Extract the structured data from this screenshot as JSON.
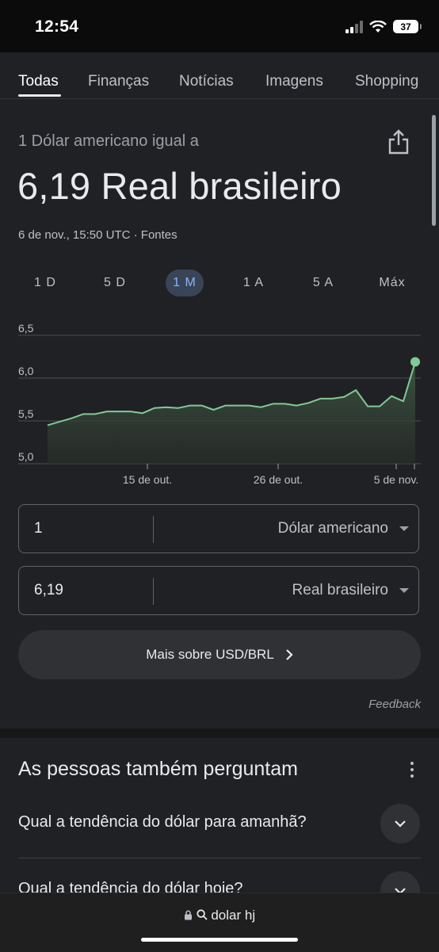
{
  "status_bar": {
    "time": "12:54",
    "battery": "37"
  },
  "tabs": [
    {
      "label": "Todas"
    },
    {
      "label": "Finanças"
    },
    {
      "label": "Notícias"
    },
    {
      "label": "Imagens"
    },
    {
      "label": "Shopping"
    }
  ],
  "converter_card": {
    "subtitle": "1 Dólar americano igual a",
    "rate": "6,19 Real brasileiro",
    "timestamp": "6 de nov., 15:50 UTC · Fontes",
    "ranges": [
      "1 D",
      "5 D",
      "1 M",
      "1 A",
      "5 A",
      "Máx"
    ],
    "active_range": "1 M"
  },
  "chart_data": {
    "type": "area",
    "x": [
      "5 de out.",
      "7 de out.",
      "8 de out.",
      "9 de out.",
      "10 de out.",
      "11 de out.",
      "14 de out.",
      "15 de out.",
      "16 de out.",
      "17 de out.",
      "18 de out.",
      "21 de out.",
      "22 de out.",
      "23 de out.",
      "24 de out.",
      "25 de out.",
      "26 de out.",
      "28 de out.",
      "29 de out.",
      "30 de out.",
      "31 de out.",
      "1 de nov.",
      "2 de nov.",
      "3 de nov.",
      "4 de nov.",
      "5 de nov.",
      "5 de nov. (2)",
      "6 de nov."
    ],
    "values": [
      5.45,
      5.49,
      5.53,
      5.58,
      5.58,
      5.61,
      5.61,
      5.61,
      5.59,
      5.65,
      5.66,
      5.65,
      5.68,
      5.68,
      5.63,
      5.68,
      5.68,
      5.68,
      5.66,
      5.7,
      5.7,
      5.68,
      5.71,
      5.76,
      5.76,
      5.78,
      5.86,
      5.67,
      5.67,
      5.79,
      5.73,
      6.19
    ],
    "y_ticks": [
      "6,5",
      "6,0",
      "5,5",
      "5,0"
    ],
    "x_ticks": [
      "15 de out.",
      "26 de out.",
      "5 de nov."
    ],
    "ylim": [
      5.0,
      6.5
    ],
    "grid": true,
    "color": "#81c995"
  },
  "converter": {
    "from_amount": "1",
    "from_currency": "Dólar americano",
    "to_amount": "6,19",
    "to_currency": "Real brasileiro"
  },
  "more_button": {
    "label": "Mais sobre USD/BRL"
  },
  "feedback": "Feedback",
  "people_also_ask": {
    "title": "As pessoas também perguntam",
    "questions": [
      "Qual a tendência do dólar para amanhã?",
      "Qual a tendência do dólar hoje?"
    ]
  },
  "browser": {
    "url": "dolar hj"
  }
}
